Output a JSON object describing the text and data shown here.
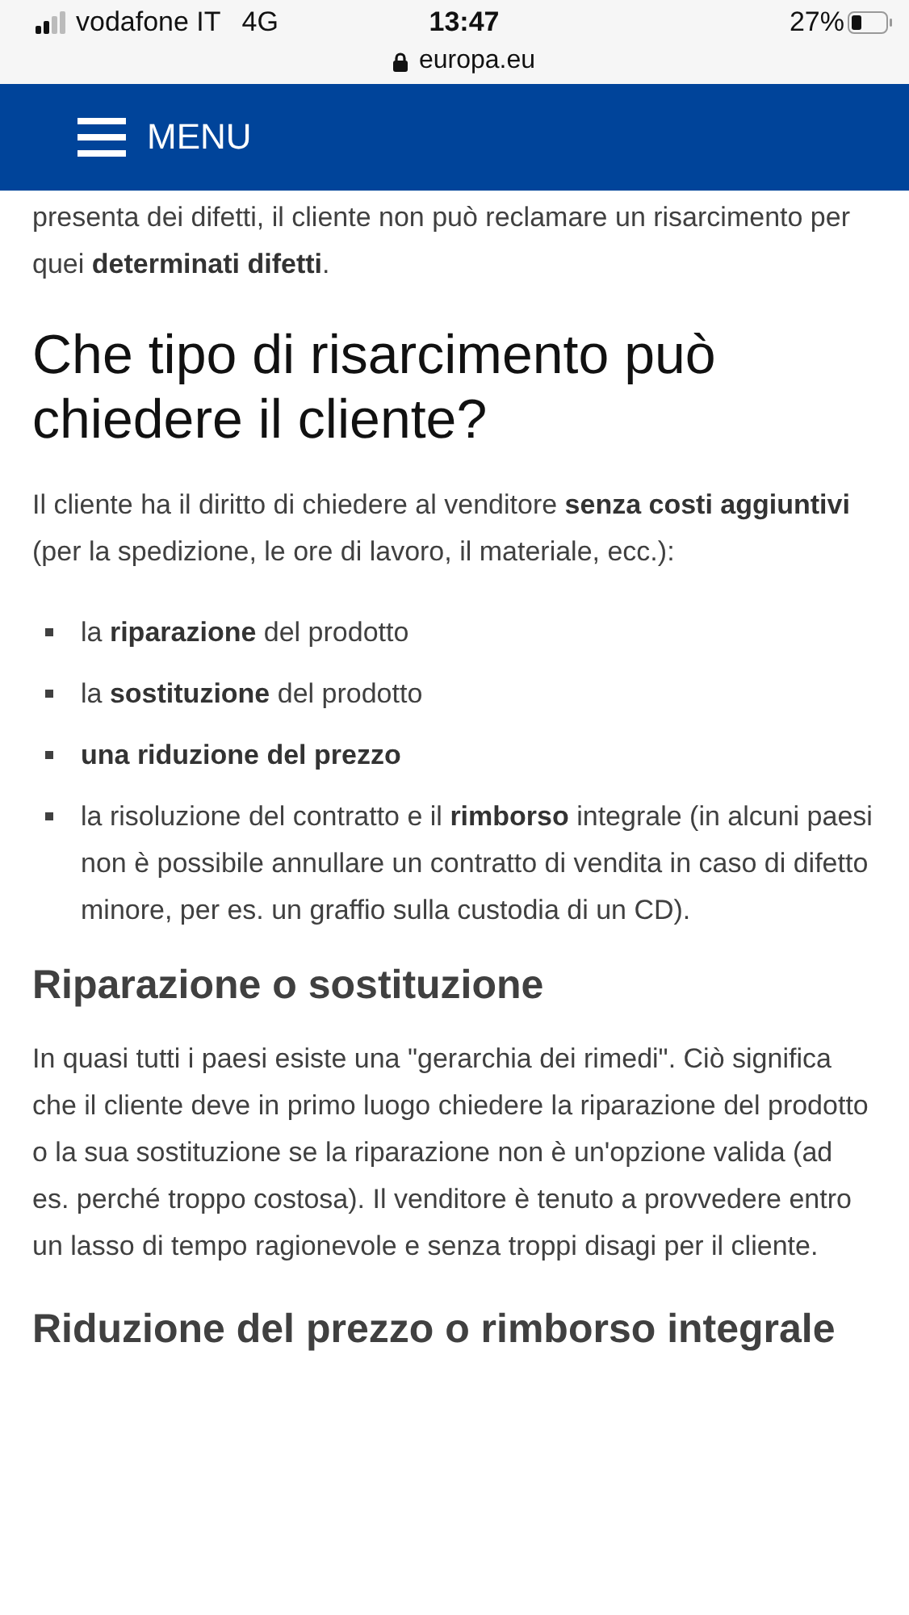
{
  "status_bar": {
    "carrier": "vodafone IT",
    "network": "4G",
    "time": "13:47",
    "battery": "27%",
    "url": "europa.eu"
  },
  "header": {
    "menu_label": "MENU"
  },
  "content": [
    {
      "kind": "paragraph",
      "text": "presenta dei difetti, il cliente non può reclamare un risarcimento per quei **determinati difetti**."
    },
    {
      "kind": "h1",
      "text": "Che tipo di risarcimento può chiedere il cliente?"
    },
    {
      "kind": "paragraph",
      "text": "Il cliente ha il diritto di chiedere al venditore **senza costi aggiuntivi** (per la spedizione, le ore di lavoro, il materiale, ecc.):"
    },
    {
      "kind": "list",
      "items": [
        "la **riparazione** del prodotto",
        "la **sostituzione** del prodotto",
        "**una riduzione del prezzo**",
        "la risoluzione del contratto e il **rimborso** integrale (in alcuni paesi non è possibile annullare un contratto di vendita in caso di difetto minore, per es. un graffio sulla custodia di un CD)."
      ]
    },
    {
      "kind": "h2",
      "text": "Riparazione o sostituzione"
    },
    {
      "kind": "paragraph",
      "text": "In quasi tutti i paesi esiste una \"gerarchia dei rimedi\". Ciò significa che il cliente deve in primo luogo chiedere la riparazione del prodotto o la sua sostituzione se la riparazione non è un'opzione valida (ad es. perché troppo costosa). Il venditore è tenuto a provvedere entro un lasso di tempo ragionevole e senza troppi disagi per il cliente."
    },
    {
      "kind": "h2",
      "text": "Riduzione del prezzo o rimborso integrale"
    }
  ]
}
